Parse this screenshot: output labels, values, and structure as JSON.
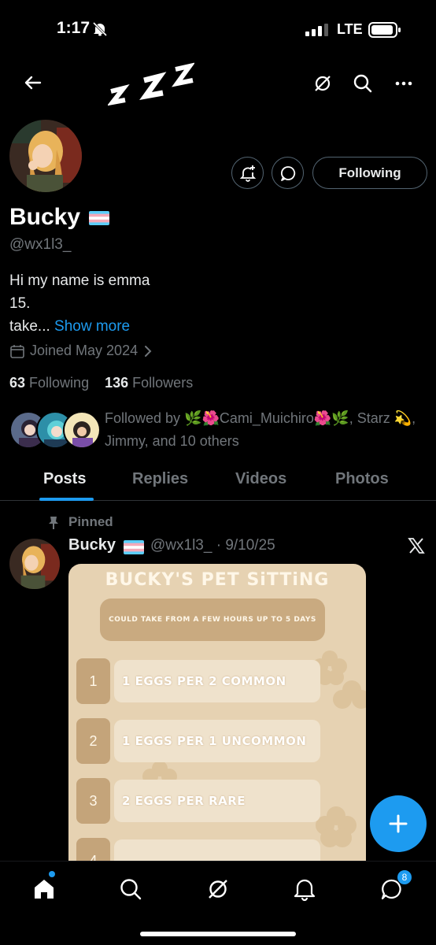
{
  "status_bar": {
    "time": "1:17",
    "network": "LTE"
  },
  "profile": {
    "display_name": "Bucky",
    "handle": "@wx1l3_",
    "bio_line1": "Hi my name is emma",
    "bio_line2": "15.",
    "bio_line3": "take...",
    "show_more": "Show more",
    "joined": "Joined May 2024",
    "following_count": "63",
    "following_label": "Following",
    "followers_count": "136",
    "followers_label": "Followers",
    "followed_by": "Followed by 🌿🌺Cami_Muichiro🌺🌿, Starz 💫, Jimmy, and 10 others",
    "follow_button": "Following"
  },
  "tabs": [
    {
      "label": "Posts",
      "active": true
    },
    {
      "label": "Replies",
      "active": false
    },
    {
      "label": "Videos",
      "active": false
    },
    {
      "label": "Photos",
      "active": false
    }
  ],
  "tweet": {
    "pinned_label": "Pinned",
    "author": "Bucky",
    "meta": "@wx1l3_ · 9/10/25",
    "media": {
      "title": "BUCKY'S PET SiTTiNG",
      "subtitle": "COULD TAKE FROM A FEW HOURS UP TO 5 DAYS",
      "rows": [
        {
          "num": "1",
          "text": "1 EGGS PER 2 COMMON"
        },
        {
          "num": "2",
          "text": "1 EGGS PER 1 UNCOMMON"
        },
        {
          "num": "3",
          "text": "2 EGGS PER RARE"
        },
        {
          "num": "4",
          "text": ""
        }
      ]
    }
  },
  "bottom_nav": {
    "messages_badge": "8"
  },
  "colors": {
    "accent": "#1d9bf0",
    "background": "#000000",
    "muted": "#71767b",
    "card": "#e6d2b2"
  }
}
